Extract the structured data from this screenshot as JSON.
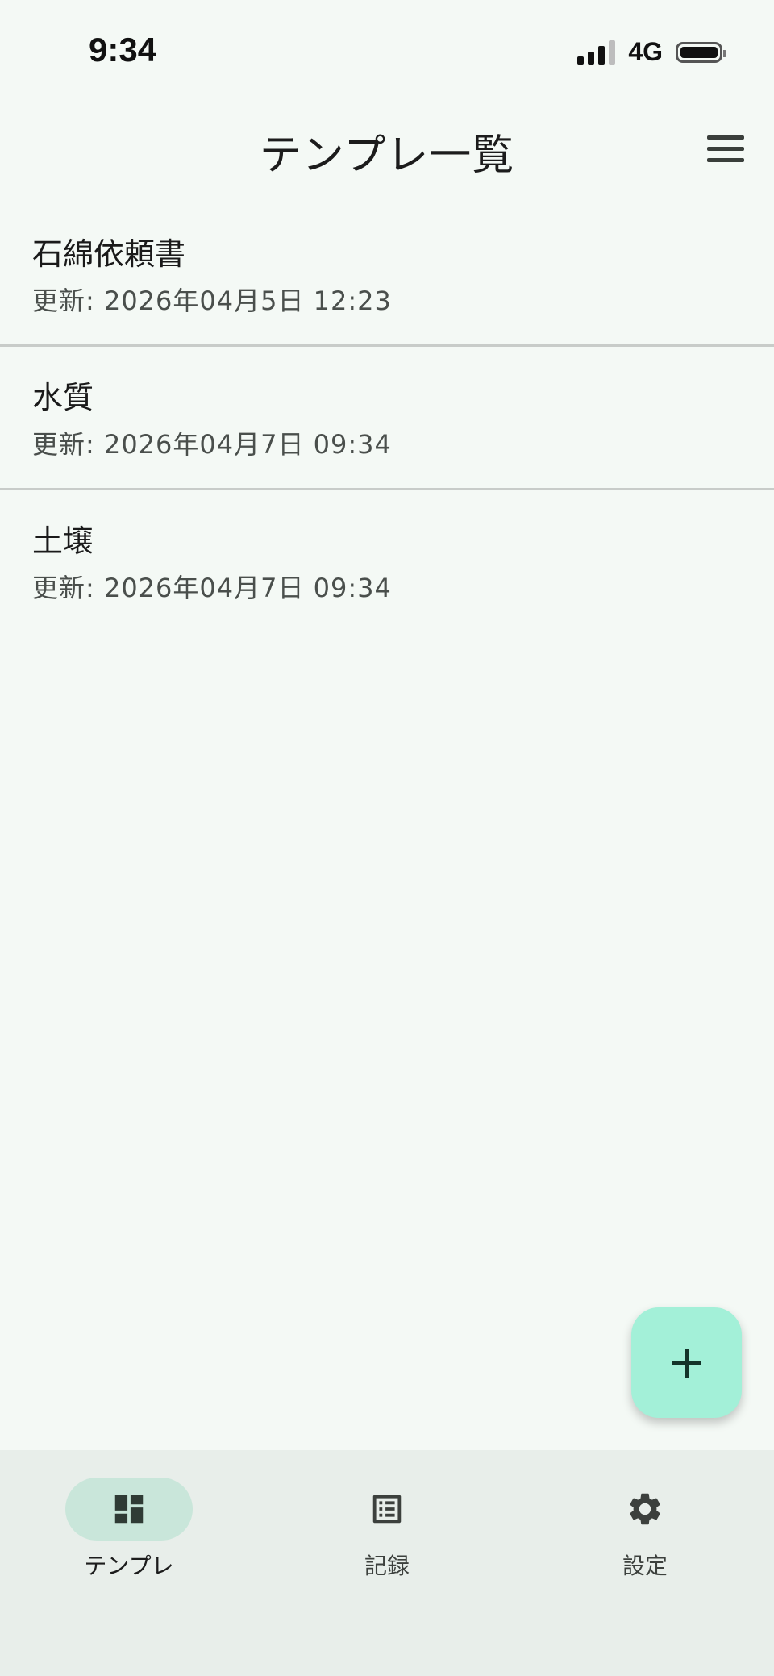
{
  "status_bar": {
    "time": "9:34",
    "network": "4G"
  },
  "app_bar": {
    "title": "テンプレ一覧",
    "menu_icon": "hamburger-menu-icon"
  },
  "templates": [
    {
      "title": "石綿依頼書",
      "subtitle": "更新: 2026年04月5日 12:23"
    },
    {
      "title": "水質",
      "subtitle": "更新: 2026年04月7日 09:34"
    },
    {
      "title": "土壌",
      "subtitle": "更新: 2026年04月7日 09:34"
    }
  ],
  "fab": {
    "icon": "plus-icon",
    "color": "#a3f0d8"
  },
  "bottom_nav": {
    "items": [
      {
        "label": "テンプレ",
        "icon": "dashboard-icon",
        "active": true
      },
      {
        "label": "記録",
        "icon": "list-alt-icon",
        "active": false
      },
      {
        "label": "設定",
        "icon": "gear-icon",
        "active": false
      }
    ]
  },
  "colors": {
    "background": "#f4f9f5",
    "nav_background": "#e8eeea",
    "active_pill": "#c9e6da",
    "divider": "#c8ccc9"
  }
}
